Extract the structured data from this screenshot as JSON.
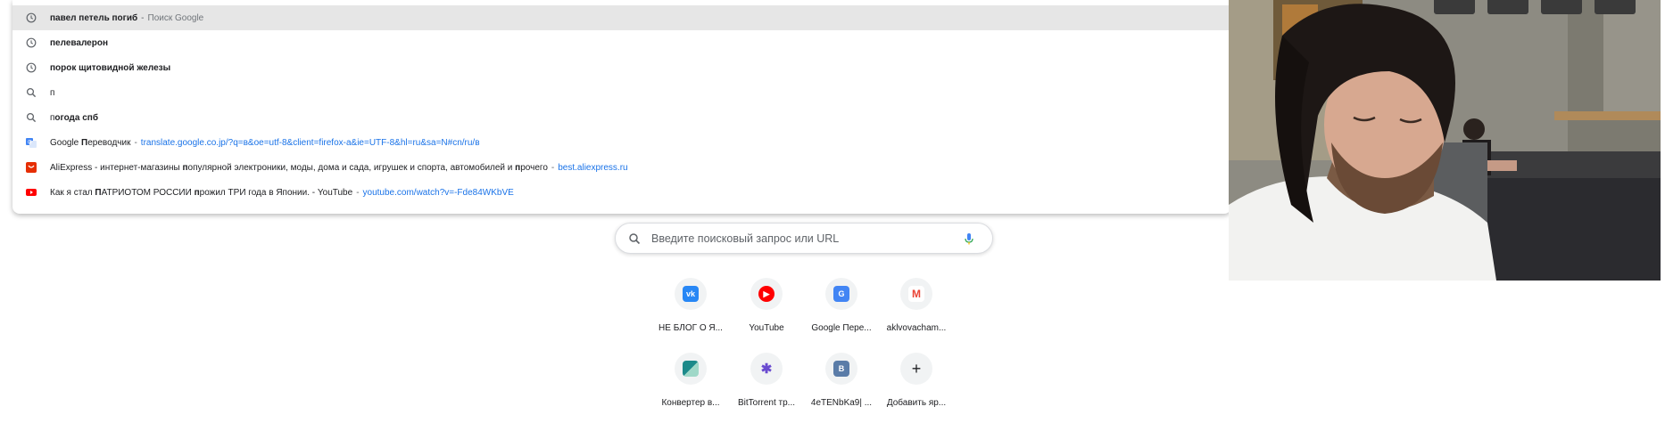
{
  "omnibox": {
    "suggestions": [
      {
        "type": "history",
        "bold": "павел петель погиб",
        "rest": "",
        "hint": "Поиск Google",
        "url": ""
      },
      {
        "type": "history",
        "bold": "пелевалерон",
        "rest": "",
        "hint": "",
        "url": ""
      },
      {
        "type": "history",
        "bold": "порок щитовидной железы",
        "rest": "",
        "hint": "",
        "url": ""
      },
      {
        "type": "search",
        "bold": "",
        "rest": "п",
        "hint": "",
        "url": ""
      },
      {
        "type": "search",
        "bold": "огода спб",
        "rest": "п",
        "hint": "",
        "url": ""
      }
    ],
    "sites": [
      {
        "icon": "google-translate",
        "title_pre": "Google ",
        "title_bold": "П",
        "title_post": "ереводчик",
        "sep": "-",
        "url": "translate.google.co.jp/?q=в&oe=utf-8&client=firefox-a&ie=UTF-8&hl=ru&sa=N#cn/ru/в"
      },
      {
        "icon": "aliexpress",
        "title_pre": "AliExpress - интернет-магазины ",
        "title_bold": "п",
        "title_post": "опулярной электроники, моды, дома и сада, игрушек и спорта, автомобилей и ",
        "title_bold2": "п",
        "title_post2": "рочего",
        "sep": "-",
        "url": "best.aliexpress.ru"
      },
      {
        "icon": "youtube",
        "title_pre": "Как я стал ",
        "title_bold": "П",
        "title_post": "АТРИОТОМ РОССИИ ",
        "title_bold2": "п",
        "title_post2": "рожил ТРИ года в Японии. - YouTube",
        "sep": "-",
        "url": "youtube.com/watch?v=-Fde84WKbVE"
      }
    ]
  },
  "search": {
    "placeholder": "Введите поисковый запрос или URL"
  },
  "shortcuts": [
    {
      "label": "НЕ БЛОГ О Я...",
      "icon": "vk",
      "color": "#2787f5",
      "glyph": "vk"
    },
    {
      "label": "YouTube",
      "icon": "youtube",
      "color": "#ff0000",
      "glyph": "▶"
    },
    {
      "label": "Google Пере...",
      "icon": "google-translate",
      "color": "#4285f4",
      "glyph": "G"
    },
    {
      "label": "aklvovacham...",
      "icon": "gmail",
      "color": "#ea4335",
      "glyph": "M"
    },
    {
      "label": "Конвертер в...",
      "icon": "converter",
      "color": "#1c8a8a",
      "glyph": ""
    },
    {
      "label": "BitTorrent тр...",
      "icon": "bittorrent",
      "color": "#6a4bd0",
      "glyph": "✱"
    },
    {
      "label": "4eTENbKa9| ...",
      "icon": "vk-b",
      "color": "#5a7ca8",
      "glyph": "B"
    },
    {
      "label": "Добавить яр...",
      "icon": "plus",
      "color": "#202124",
      "glyph": "+"
    }
  ],
  "colors": {
    "accent": "#1a73e8",
    "hover": "#e6e6e6"
  }
}
